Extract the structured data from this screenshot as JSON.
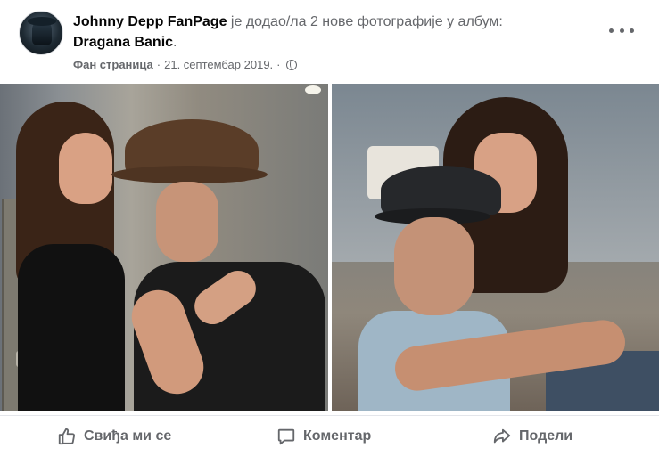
{
  "post": {
    "page_name": "Johnny Depp FanPage",
    "action_text": "је додао/ла 2 нове фотографије у албум:",
    "album_name": "Dragana Banic",
    "album_suffix": ".",
    "page_label": "Фан страница",
    "separator": "·",
    "date": "21. септембар 2019.",
    "date_separator": "·",
    "privacy_icon": "globe-icon",
    "more_icon": "more-options-icon"
  },
  "photos": [
    {
      "name": "photo-1"
    },
    {
      "name": "photo-2"
    }
  ],
  "actions": {
    "like_label": "Свиђа ми се",
    "comment_label": "Коментар",
    "share_label": "Подели",
    "like_icon": "thumbs-up-icon",
    "comment_icon": "comment-bubble-icon",
    "share_icon": "share-arrow-icon"
  },
  "colors": {
    "primary_text": "#050505",
    "secondary_text": "#65676b",
    "divider": "#e4e6eb"
  }
}
